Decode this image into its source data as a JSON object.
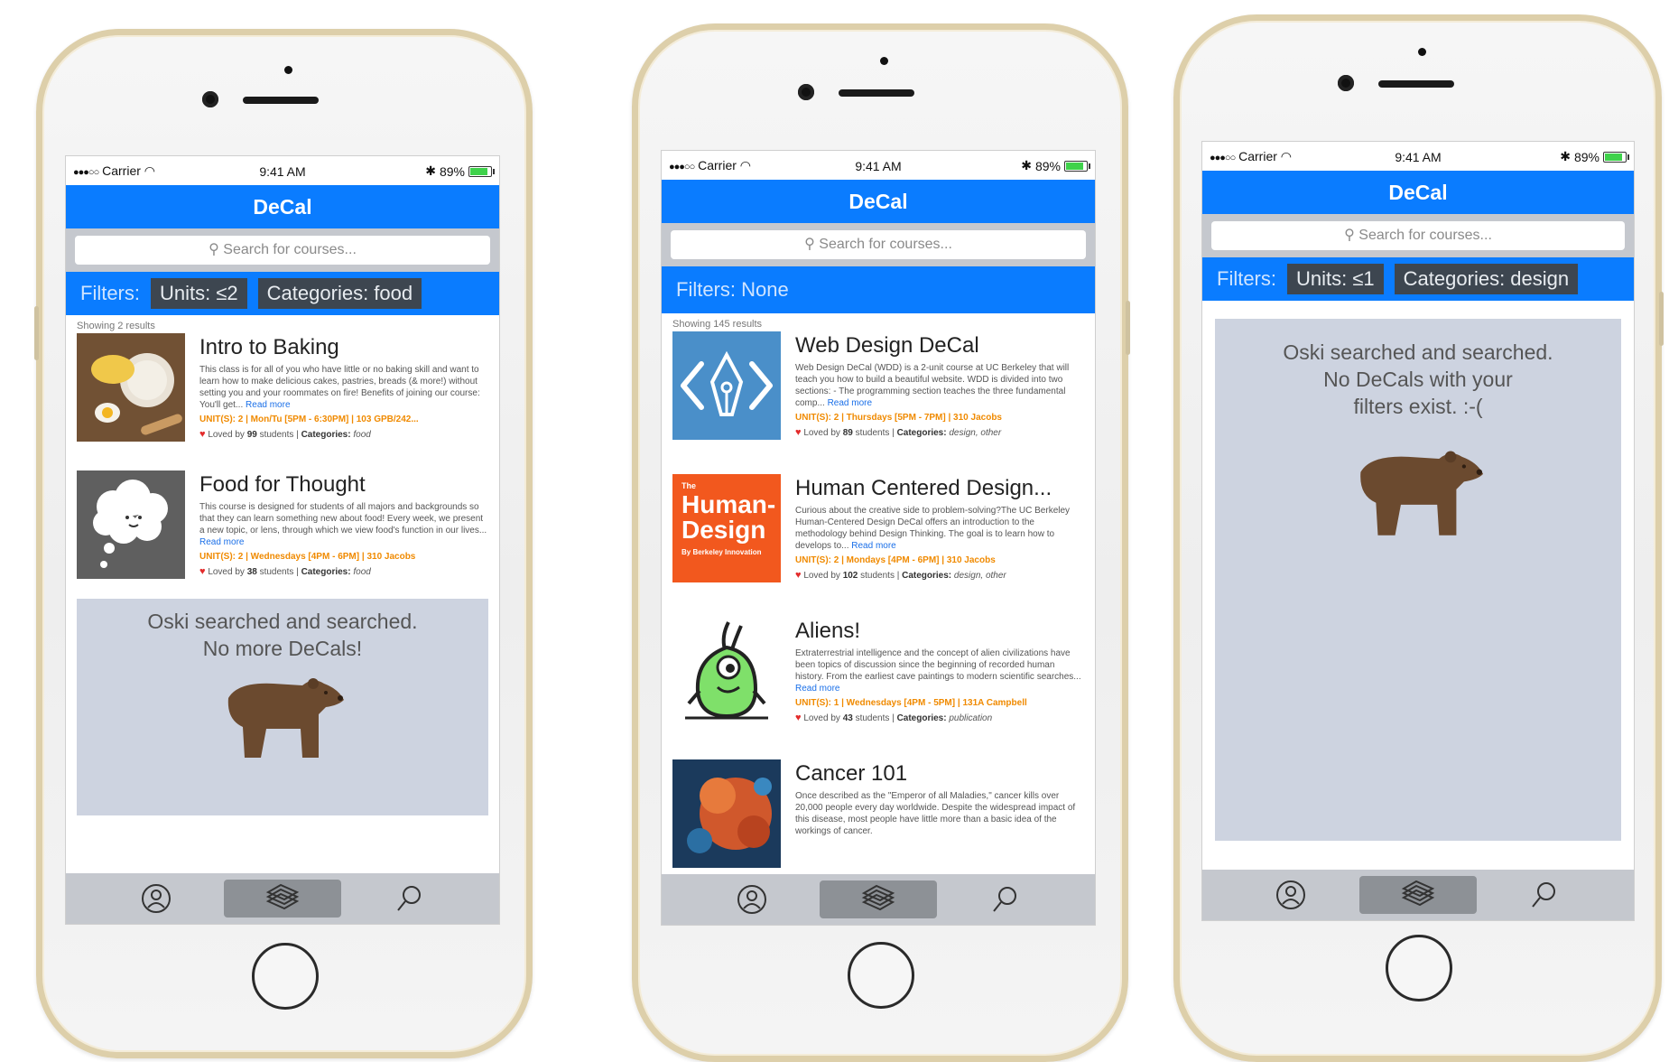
{
  "status": {
    "carrier": "Carrier",
    "time": "9:41 AM",
    "battery": "89%",
    "bluetooth": "✱"
  },
  "app": {
    "title": "DeCal",
    "search_placeholder": "Search for courses..."
  },
  "phones": [
    {
      "filters_label": "Filters:",
      "chips": [
        "Units: ≤2",
        "Categories: food"
      ],
      "showing": "Showing 2 results",
      "courses": [
        {
          "title": "Intro to Baking",
          "desc": "This class is for all of you who have little or no baking skill and want to learn how to make delicious cakes, pastries, breads (& more!) without setting you and your roommates on fire! Benefits of joining our course: You'll get...",
          "read_more": "Read more",
          "meta": "UNIT(S): 2 | Mon/Tu [5PM - 6:30PM] | 103 GPB/242...",
          "loved_prefix": "Loved by",
          "loved_count": "99",
          "loved_suffix": "students |",
          "cat_label": "Categories:",
          "categories": "food",
          "thumb": "baking-photo"
        },
        {
          "title": "Food for Thought",
          "desc": "This course is designed for students of all majors and backgrounds so that they can learn something new about food! Every week, we present a new topic, or lens, through which we view food's function in our lives...",
          "read_more": "Read more",
          "meta": "UNIT(S): 2 | Wednesdays [4PM - 6PM] | 310 Jacobs",
          "loved_prefix": "Loved by",
          "loved_count": "38",
          "loved_suffix": "students |",
          "cat_label": "Categories:",
          "categories": "food",
          "thumb": "thought-cloud-icon"
        }
      ],
      "empty_line1": "Oski searched and searched.",
      "empty_line2": "No more DeCals!"
    },
    {
      "filters_label": "Filters: None",
      "showing": "Showing 145 results",
      "courses": [
        {
          "title": "Web Design DeCal",
          "desc": "Web Design DeCal (WDD) is a 2-unit course at UC Berkeley that will teach you how to build a beautiful website. WDD is divided into two sections: - The programming section teaches the three fundamental comp...",
          "read_more": "Read more",
          "meta": "UNIT(S): 2 | Thursdays [5PM - 7PM] | 310 Jacobs",
          "loved_prefix": "Loved by",
          "loved_count": "89",
          "loved_suffix": "students |",
          "cat_label": "Categories:",
          "categories": "design, other",
          "thumb": "pen-nib-code-icon"
        },
        {
          "title": "Human Centered Design...",
          "desc": "Curious about the creative side to problem-solving?The UC Berkeley Human-Centered Design DeCal offers an introduction to the methodology behind Design Thinking. The goal is to learn how to develops to...",
          "read_more": "Read more",
          "meta": "UNIT(S): 2 | Mondays [4PM - 6PM] | 310 Jacobs",
          "loved_prefix": "Loved by",
          "loved_count": "102",
          "loved_suffix": "students |",
          "cat_label": "Categories:",
          "categories": "design, other",
          "thumb": "human-design-logo",
          "thumb_text": {
            "small": "The",
            "line1": "Human-",
            "line2": "Design",
            "line3": "By Berkeley Innovation"
          }
        },
        {
          "title": "Aliens!",
          "desc": "Extraterrestrial intelligence and the concept of alien civilizations have been topics of discussion since the beginning of recorded human history. From the earliest cave paintings to modern scientific searches...",
          "read_more": "Read more",
          "meta": "UNIT(S): 1 | Wednesdays [4PM - 5PM] | 131A Campbell",
          "loved_prefix": "Loved by",
          "loved_count": "43",
          "loved_suffix": "students |",
          "cat_label": "Categories:",
          "categories": "publication",
          "thumb": "alien-icon"
        },
        {
          "title": "Cancer 101",
          "desc": "Once described as the \"Emperor of all Maladies,\" cancer kills over 20,000 people every day worldwide. Despite the widespread impact of this disease, most people have little more than a basic idea of the workings of cancer.",
          "thumb": "cancer-cell-photo"
        }
      ]
    },
    {
      "filters_label": "Filters:",
      "chips": [
        "Units: ≤1",
        "Categories: design"
      ],
      "empty_line1": "Oski searched and searched.",
      "empty_line2": "No DeCals with your",
      "empty_line3": "filters exist. :-("
    }
  ],
  "colors": {
    "appbar": "#0a7cff",
    "chip": "#3d4650",
    "empty_panel": "#cdd3e0",
    "tabbar": "#c5c8ce",
    "meta": "#f08a00"
  },
  "tabs": [
    "profile-icon",
    "courses-stack-icon",
    "search-icon"
  ]
}
